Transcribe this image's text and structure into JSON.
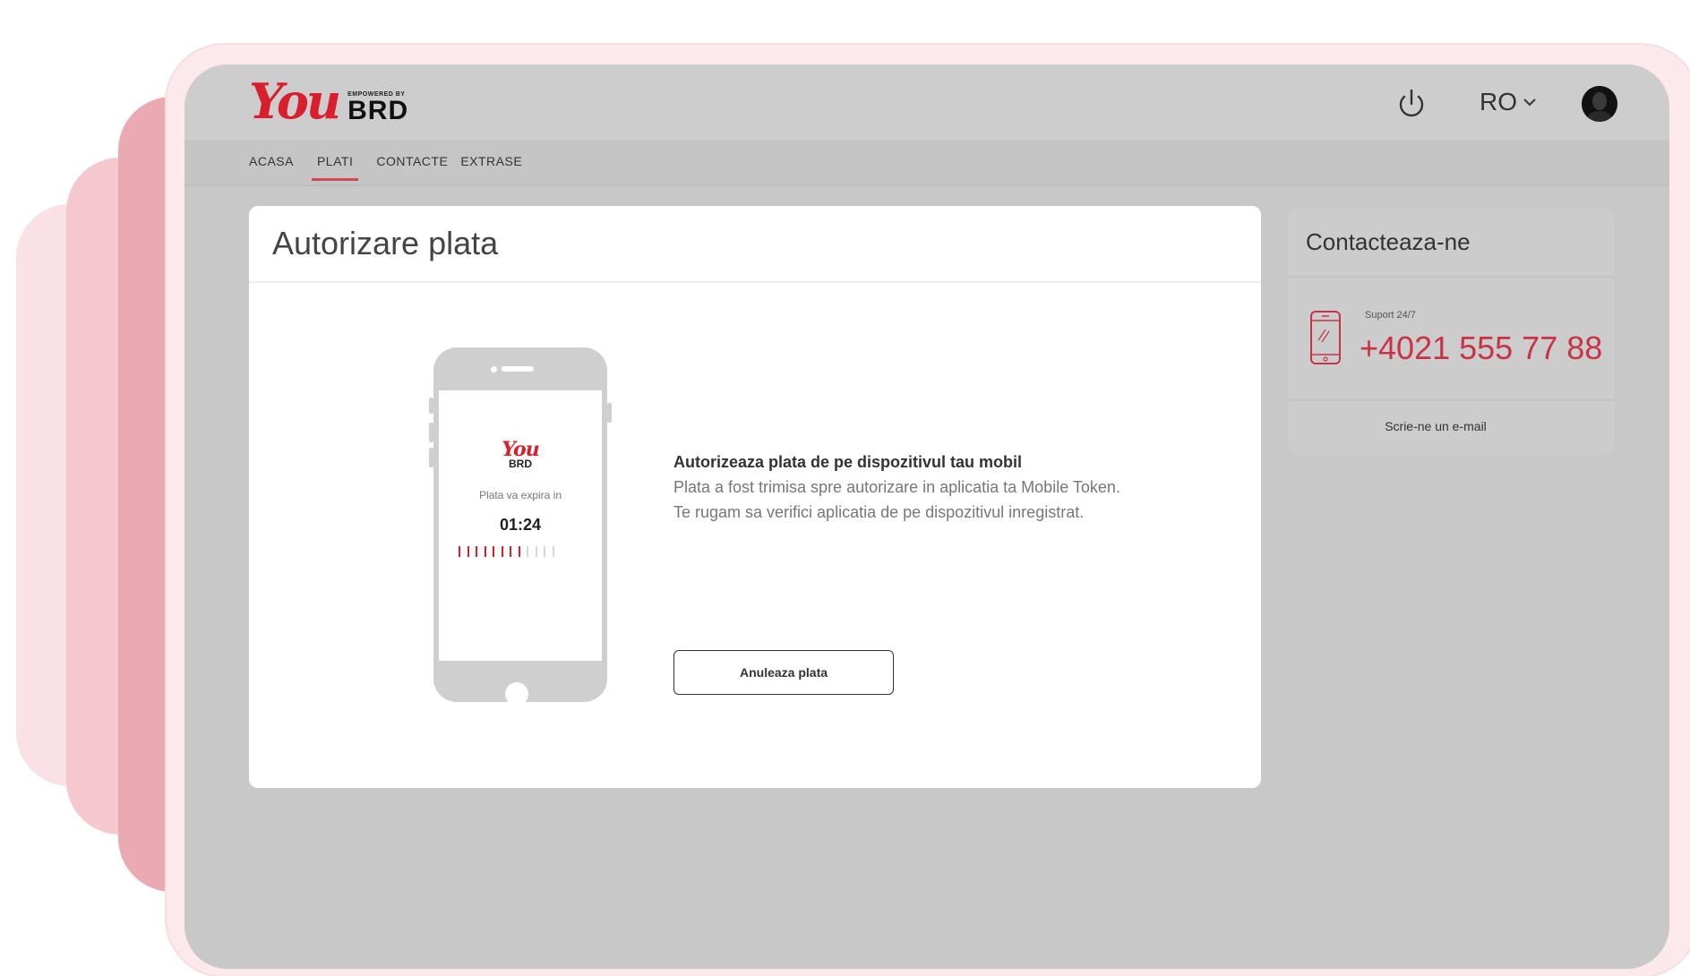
{
  "logo": {
    "you": "You",
    "powered_by": "EMPOWERED BY",
    "brand": "BRD"
  },
  "header": {
    "language": "RO"
  },
  "nav": {
    "items": [
      "ACASA",
      "PLATI",
      "CONTACTE",
      "EXTRASE"
    ],
    "active": "PLATI"
  },
  "main": {
    "title": "Autorizare plata",
    "phone": {
      "logo_you": "You",
      "logo_brd": "BRD",
      "expire_label": "Plata va expira in",
      "timer": "01:24",
      "countdown_fraction_remaining": 0.67
    },
    "message": {
      "title": "Autorizeaza plata de pe dispozitivul tau mobil",
      "body": "Plata a fost trimisa spre autorizare in aplicatia ta Mobile Token. Te rugam sa verifici aplicatia de pe dispozitivul inregistrat."
    },
    "cancel_label": "Anuleaza plata"
  },
  "sidebar": {
    "title": "Contacteaza-ne",
    "support_label": "Suport 24/7",
    "support_number": "+4021 555 77 88",
    "email_link": "Scrie-ne un e-mail"
  },
  "colors": {
    "brand_red": "#d91e2d",
    "accent_pink": "#c83447",
    "tick_active": "#d91e2d",
    "tick_inactive": "#d8d8d8"
  }
}
